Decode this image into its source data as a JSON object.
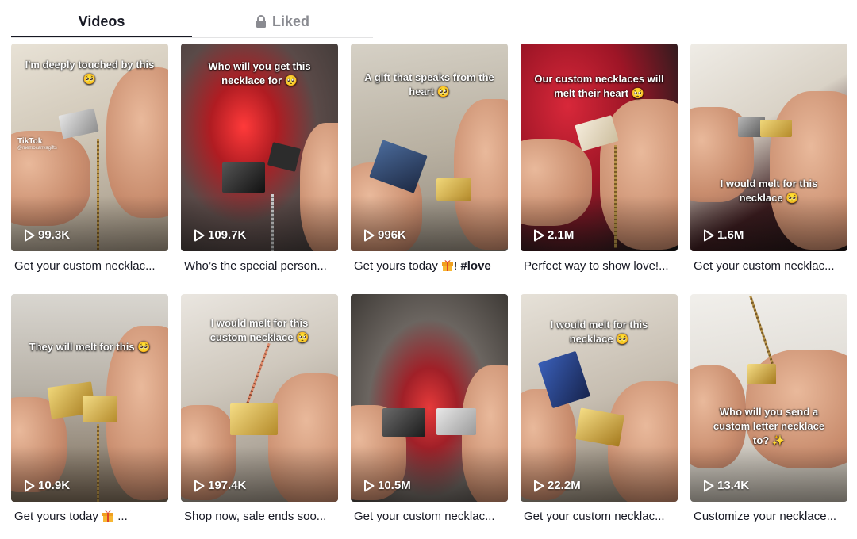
{
  "tabs": {
    "videos_label": "Videos",
    "liked_label": "Liked"
  },
  "colors": {
    "text_primary": "#161823",
    "text_secondary": "#8a8b91",
    "divider": "#e3e3e4"
  },
  "videos": [
    {
      "overlay": "I'm deeply touched by this 🥺",
      "views": "99.3K",
      "caption": "Get your custom necklac...",
      "watermark": "TikTok",
      "watermark_handle": "@memocanvagifts"
    },
    {
      "overlay": "Who will you get this necklace for 🥺",
      "views": "109.7K",
      "caption": "Who’s the special person..."
    },
    {
      "overlay": "A gift that speaks from the heart 🥺",
      "views": "996K",
      "caption_prefix": "Get yours today ",
      "caption_suffix": "! ",
      "caption_tag": "#love"
    },
    {
      "overlay": "Our custom necklaces will melt their heart 🥺",
      "views": "2.1M",
      "caption": "Perfect way to show love!..."
    },
    {
      "overlay": "I would melt for this necklace 🥺",
      "views": "1.6M",
      "caption": "Get your custom necklac..."
    },
    {
      "overlay": "They will melt for this 🥺",
      "views": "10.9K",
      "caption_prefix": "Get yours today ",
      "caption_suffix": " ..."
    },
    {
      "overlay": "I would melt for this custom necklace 🥺",
      "views": "197.4K",
      "caption": "Shop now, sale ends soo..."
    },
    {
      "overlay": "",
      "views": "10.5M",
      "caption": "Get your custom necklac..."
    },
    {
      "overlay": "I would melt for this necklace 🥺",
      "views": "22.2M",
      "caption": "Get your custom necklac..."
    },
    {
      "overlay": "Who will you send a custom letter necklace to? ✨",
      "views": "13.4K",
      "caption": "Customize your necklace..."
    }
  ]
}
